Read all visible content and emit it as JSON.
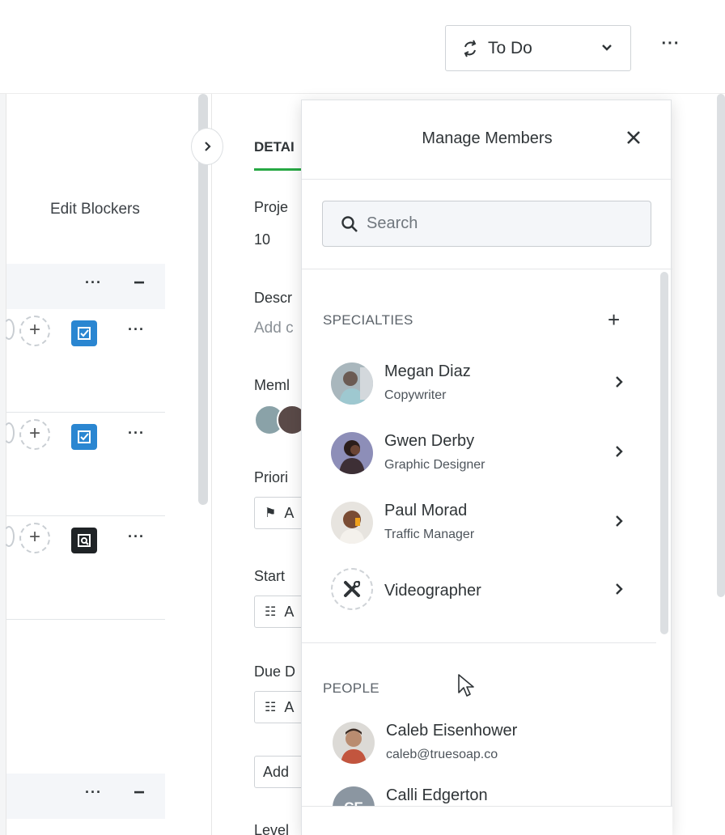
{
  "topbar": {
    "status_label": "To Do",
    "status_icon": "status-cycle-icon",
    "more_label": "···"
  },
  "left_panel": {
    "edit_blockers": "Edit Blockers",
    "more_label": "···",
    "minus_label": "−",
    "plus_label": "+"
  },
  "details": {
    "tab_label": "DETAI",
    "project_label": "Proje",
    "project_value": "10",
    "description_label": "Descr",
    "description_link": "Add c",
    "members_label": "Meml",
    "priority_label": "Priori",
    "priority_field": "A",
    "start_label": "Start",
    "start_field": "A",
    "due_label": "Due D",
    "due_field": "A",
    "add_button": "Add",
    "level_label": "Level"
  },
  "modal": {
    "title": "Manage Members",
    "search_placeholder": "Search",
    "specialties_label": "SPECIALTIES",
    "people_label": "PEOPLE",
    "specialties": [
      {
        "name": "Megan Diaz",
        "role": "Copywriter"
      },
      {
        "name": "Gwen Derby",
        "role": "Graphic Designer"
      },
      {
        "name": "Paul Morad",
        "role": "Traffic Manager"
      },
      {
        "name": "Videographer"
      }
    ],
    "people": [
      {
        "name": "Caleb Eisenhower",
        "email": "caleb@truesoap.co"
      },
      {
        "name": "Calli Edgerton",
        "initials": "CE"
      }
    ]
  },
  "colors": {
    "accent_green": "#27a844",
    "check_blue": "#2a86d1",
    "check_dark": "#1f2326"
  }
}
